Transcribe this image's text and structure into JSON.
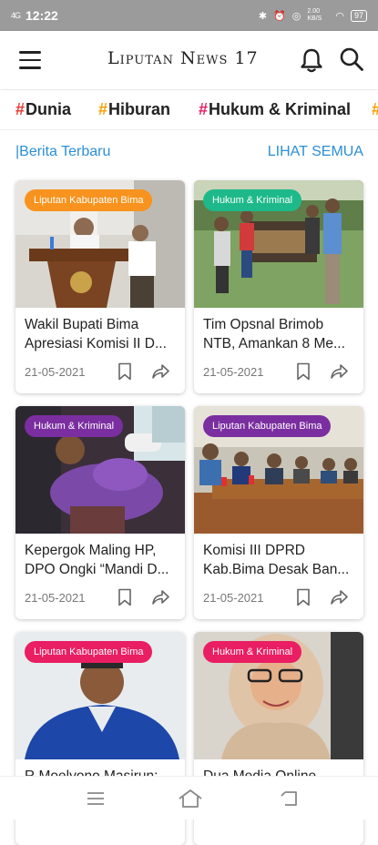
{
  "status": {
    "signal": "4G",
    "time": "12:22",
    "speed": "2.00 KB/S",
    "battery": "97"
  },
  "app": {
    "title": "Liputan News 17"
  },
  "categories": [
    {
      "hash": "#",
      "label": "Dunia",
      "hash_color": "#e53935"
    },
    {
      "hash": "#",
      "label": "Hiburan",
      "hash_color": "#f4a000"
    },
    {
      "hash": "#",
      "label": "Hukum & Kriminal",
      "hash_color": "#e91e63"
    }
  ],
  "section": {
    "title": "|Berita Terbaru",
    "see_all": "LIHAT SEMUA",
    "accent": "#2b8fd6"
  },
  "cards": [
    {
      "tag": "Liputan Kabupaten Bima",
      "tag_color": "#f7931e",
      "title": " Wakil Bupati Bima Apresiasi Komisi II D...",
      "date": "21-05-2021"
    },
    {
      "tag": "Hukum & Kriminal",
      "tag_color": "#1eb98a",
      "title": "Tim Opsnal Brimob NTB, Amankan 8 Me...",
      "date": "21-05-2021"
    },
    {
      "tag": "Hukum & Kriminal",
      "tag_color": "#7b2ea0",
      "title": "Kepergok Maling HP, DPO Ongki  “Mandi D...",
      "date": "21-05-2021"
    },
    {
      "tag": "Liputan Kabupaten Bima",
      "tag_color": "#7b2ea0",
      "title": "Komisi III DPRD Kab.Bima Desak Ban...",
      "date": "21-05-2021"
    },
    {
      "tag": "Liputan Kabupaten Bima",
      "tag_color": "#e91e63",
      "title": "R Moelyono Masirun:",
      "date": ""
    },
    {
      "tag": "Hukum & Kriminal",
      "tag_color": "#e91e63",
      "title": "Dua Media Online",
      "date": ""
    }
  ],
  "icons": {
    "menu": "menu-icon",
    "bell": "bell-icon",
    "search": "search-icon",
    "bookmark": "bookmark-icon",
    "share": "share-icon"
  }
}
